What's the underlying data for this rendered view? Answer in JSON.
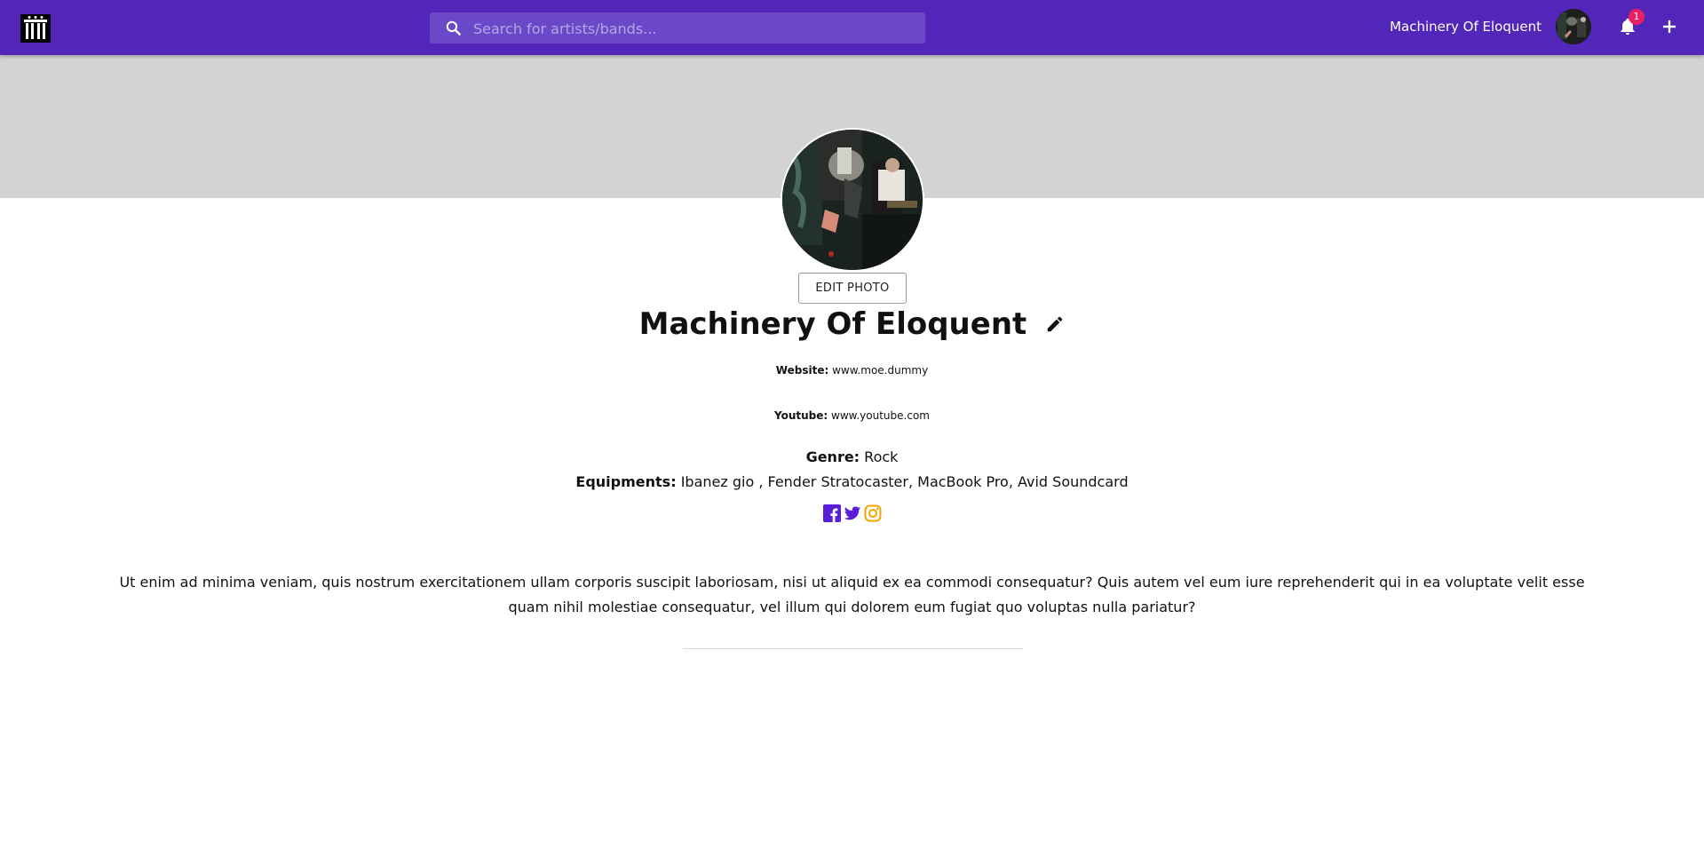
{
  "header": {
    "search_placeholder": "Search for artists/bands...",
    "username": "Machinery Of Eloquent",
    "notification_count": "1",
    "brand_color": "#5126b8"
  },
  "profile": {
    "edit_photo_label": "EDIT PHOTO",
    "name": "Machinery Of Eloquent",
    "website_label": "Website:",
    "website_value": "www.moe.dummy",
    "youtube_label": "Youtube:",
    "youtube_value": "www.youtube.com",
    "genre_label": "Genre:",
    "genre_value": "Rock",
    "equipments_label": "Equipments:",
    "equipments_value": "Ibanez gio , Fender Stratocaster, MacBook Pro, Avid Soundcard",
    "socials": [
      "facebook-icon",
      "twitter-icon",
      "instagram-icon"
    ],
    "bio": "Ut enim ad minima veniam, quis nostrum exercitationem ullam corporis suscipit laboriosam, nisi ut aliquid ex ea commodi consequatur? Quis autem vel eum iure reprehenderit qui in ea voluptate velit esse quam nihil molestiae consequatur, vel illum qui dolorem eum fugiat quo voluptas nulla pariatur?"
  }
}
